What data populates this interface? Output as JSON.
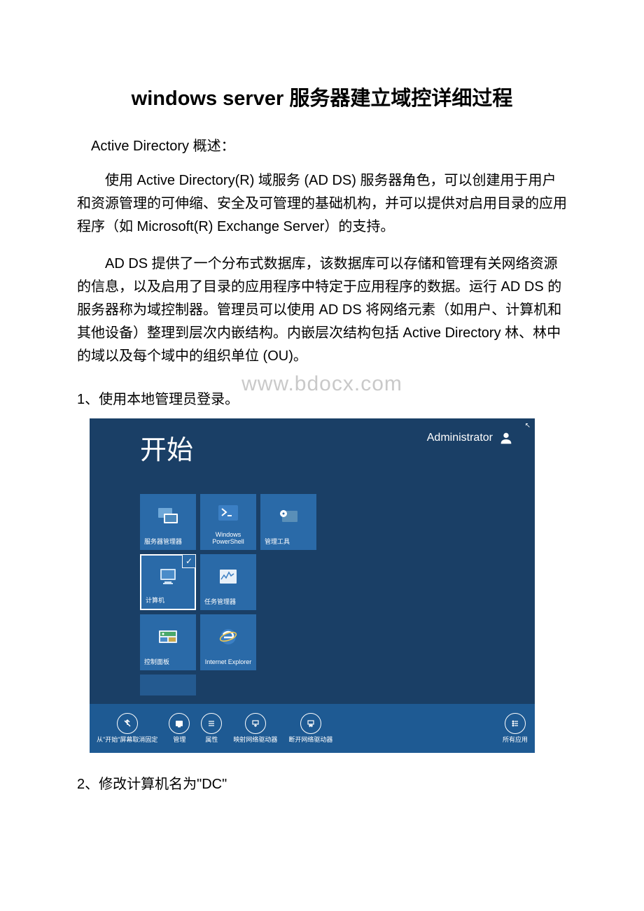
{
  "title": "windows server 服务器建立域控详细过程",
  "subtitle": "Active Directory 概述：",
  "para1": "使用 Active Directory(R) 域服务 (AD DS) 服务器角色，可以创建用于用户和资源管理的可伸缩、安全及可管理的基础机构，并可以提供对启用目录的应用程序（如 Microsoft(R) Exchange Server）的支持。",
  "para2": "AD DS 提供了一个分布式数据库，该数据库可以存储和管理有关网络资源的信息，以及启用了目录的应用程序中特定于应用程序的数据。运行 AD DS 的服务器称为域控制器。管理员可以使用 AD DS 将网络元素（如用户、计算机和其他设备）整理到层次内嵌结构。内嵌层次结构包括 Active Directory 林、林中的域以及每个域中的组织单位 (OU)。",
  "step1": "1、使用本地管理员登录。",
  "step2": "2、修改计算机名为\"DC\"",
  "watermark": "www.bdocx.com",
  "startscreen": {
    "title": "开始",
    "user": "Administrator",
    "tiles": [
      {
        "label": "服务器管理器"
      },
      {
        "label": "Windows PowerShell"
      },
      {
        "label": "管理工具"
      },
      {
        "label": "计算机"
      },
      {
        "label": "任务管理器"
      },
      {
        "label": "控制面板"
      },
      {
        "label": "Internet Explorer"
      }
    ],
    "appbar": [
      {
        "label": "从\"开始\"屏幕取消固定"
      },
      {
        "label": "管理"
      },
      {
        "label": "属性"
      },
      {
        "label": "映射网络驱动器"
      },
      {
        "label": "断开网络驱动器"
      },
      {
        "label": "所有应用"
      }
    ]
  }
}
